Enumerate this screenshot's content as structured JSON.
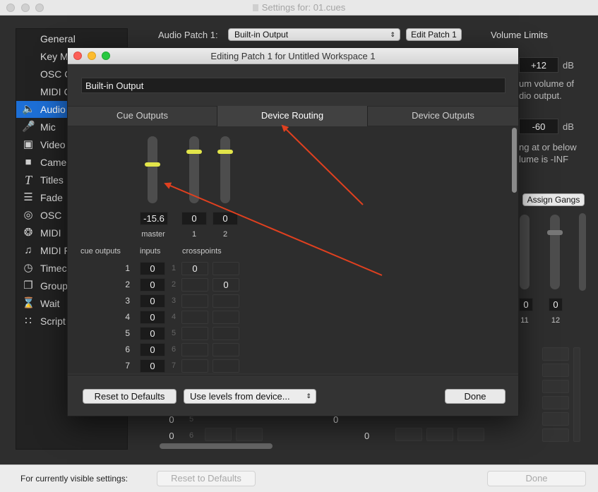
{
  "window": {
    "title": "Settings for: 01.cues"
  },
  "sidebar": {
    "items": [
      {
        "label": "General",
        "icon": "none"
      },
      {
        "label": "Key M",
        "icon": "none"
      },
      {
        "label": "OSC C",
        "icon": "none"
      },
      {
        "label": "MIDI C",
        "icon": "none"
      },
      {
        "label": "Audio",
        "icon": "speaker-icon",
        "selected": true
      },
      {
        "label": "Mic",
        "icon": "mic-icon"
      },
      {
        "label": "Video",
        "icon": "film-icon"
      },
      {
        "label": "Camer",
        "icon": "camera-icon"
      },
      {
        "label": "Titles",
        "icon": "titles-icon"
      },
      {
        "label": "Fade",
        "icon": "fade-icon"
      },
      {
        "label": "OSC",
        "icon": "osc-icon"
      },
      {
        "label": "MIDI",
        "icon": "midi-icon"
      },
      {
        "label": "MIDI F",
        "icon": "note-icon"
      },
      {
        "label": "Timec",
        "icon": "clock-icon"
      },
      {
        "label": "Group",
        "icon": "group-icon"
      },
      {
        "label": "Wait",
        "icon": "hourglass-icon"
      },
      {
        "label": "Script",
        "icon": "script-icon"
      }
    ]
  },
  "main": {
    "audio_patch_label": "Audio Patch 1:",
    "audio_patch_value": "Built-in Output",
    "edit_patch_label": "Edit Patch 1",
    "volume_limits_label": "Volume Limits",
    "max_value": "+12",
    "max_unit": "dB",
    "max_desc_1": "um volume of",
    "max_desc_2": "dio output.",
    "min_value": "-60",
    "min_unit": "dB",
    "min_desc_1": "ng at or below",
    "min_desc_2": "lume is -INF",
    "assign_gangs_label": "Assign Gangs",
    "bg_values": [
      "0",
      "0"
    ],
    "bg_labels": [
      "11",
      "12"
    ],
    "bg_rows": [
      {
        "a": "0",
        "b": "5",
        "c": "0"
      },
      {
        "a": "0",
        "b": "6",
        "c": "0"
      }
    ]
  },
  "dialog": {
    "title": "Editing Patch 1 for Untitled Workspace 1",
    "patch_name": "Built-in Output",
    "tabs": [
      "Cue Outputs",
      "Device Routing",
      "Device Outputs"
    ],
    "selected_tab": "Device Routing",
    "faders": [
      {
        "label": "master",
        "value": "-15.6",
        "level": 0.58
      },
      {
        "label": "1",
        "value": "0",
        "level": 0.77
      },
      {
        "label": "2",
        "value": "0",
        "level": 0.77
      }
    ],
    "headers": {
      "cue_outputs": "cue outputs",
      "inputs": "inputs",
      "crosspoints": "crosspoints"
    },
    "rows": [
      {
        "num": "1",
        "input": "0",
        "ch": "1",
        "x1": "0",
        "x2": ""
      },
      {
        "num": "2",
        "input": "0",
        "ch": "2",
        "x1": "",
        "x2": "0"
      },
      {
        "num": "3",
        "input": "0",
        "ch": "3",
        "x1": "",
        "x2": ""
      },
      {
        "num": "4",
        "input": "0",
        "ch": "4",
        "x1": "",
        "x2": ""
      },
      {
        "num": "5",
        "input": "0",
        "ch": "5",
        "x1": "",
        "x2": ""
      },
      {
        "num": "6",
        "input": "0",
        "ch": "6",
        "x1": "",
        "x2": ""
      },
      {
        "num": "7",
        "input": "0",
        "ch": "7",
        "x1": "",
        "x2": ""
      }
    ],
    "reset_label": "Reset to Defaults",
    "levels_popup": "Use levels from device...",
    "done_label": "Done"
  },
  "footer": {
    "label": "For currently visible settings:",
    "reset_label": "Reset to Defaults",
    "done_label": "Done"
  },
  "colors": {
    "accent": "#1d6fd6",
    "knob": "#e2e54a",
    "arrow": "#e0401f"
  }
}
